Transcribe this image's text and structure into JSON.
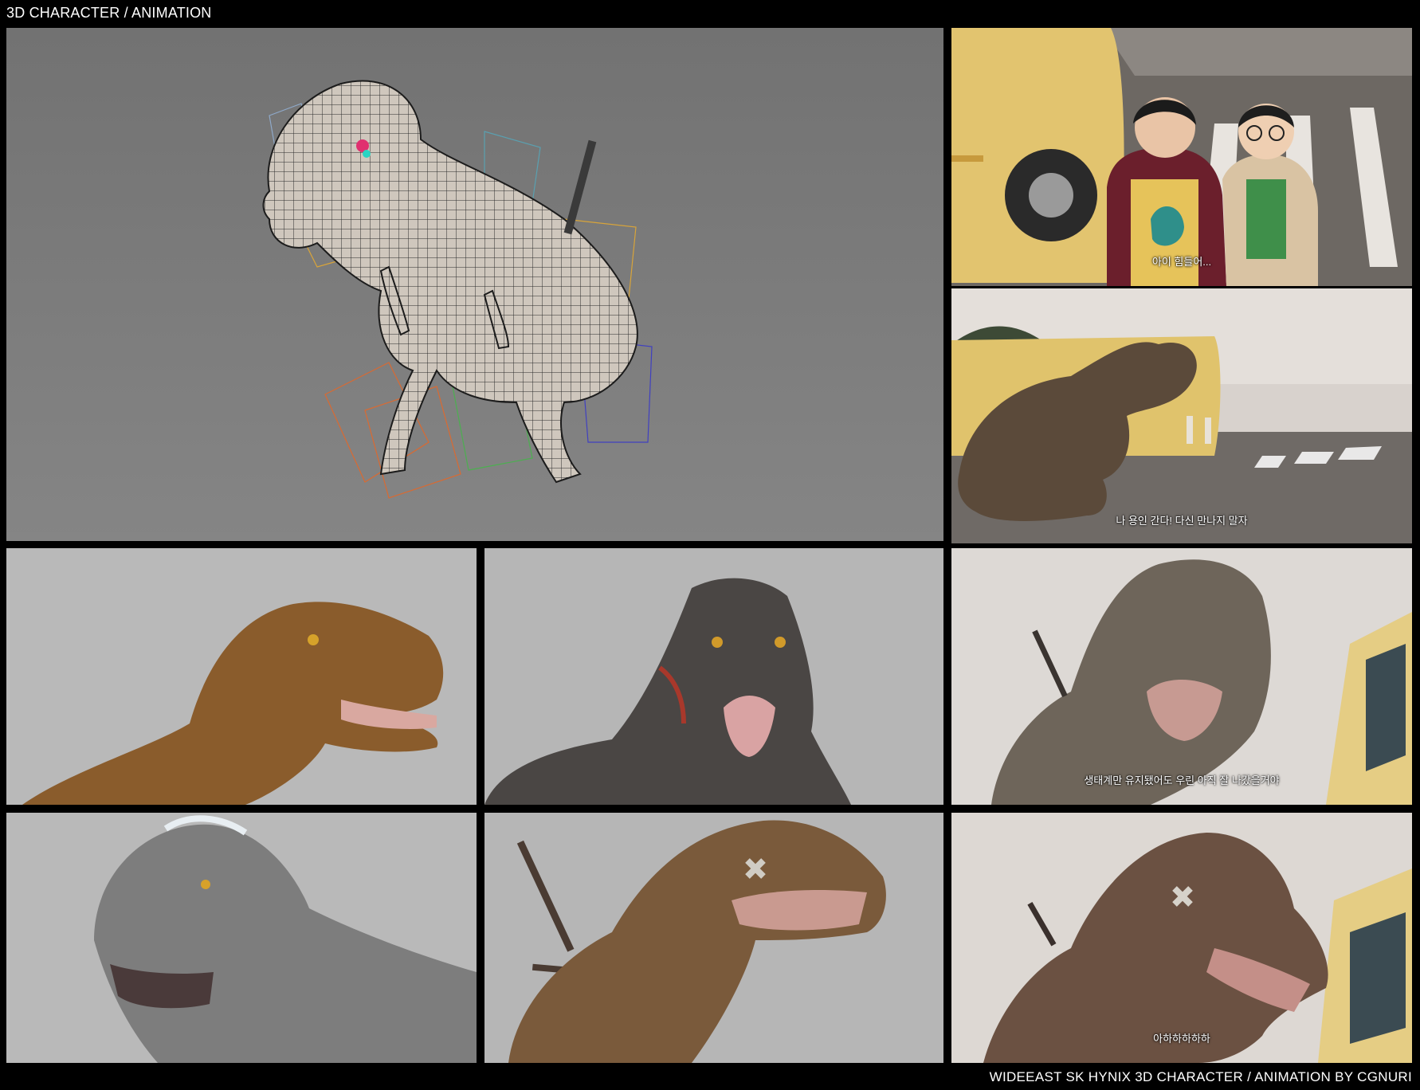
{
  "header": {
    "title": "3D CHARACTER / ANIMATION"
  },
  "footer": {
    "credit": "WIDEEAST SK HYNIX 3D CHARACTER / ANIMATION BY CGNURI"
  },
  "panels": {
    "wireframe": {
      "subject": "t-rex-wireframe-rig"
    },
    "bus_kids": {
      "subtitle": "아이 힘들어..."
    },
    "dino_bus": {
      "subtitle": "나 용인 간다! 다신 만나지 말자"
    },
    "dino_closeup_sky": {
      "subtitle": "생태계만 유지됐어도 우린 아직 잘 나갔을거야"
    },
    "dino_laugh": {
      "subtitle": "아하하하하하"
    }
  },
  "colors": {
    "background": "#000000",
    "studio_grey": "#b9b9b9",
    "wire_grey": "#7a7a7a",
    "bus_yellow": "#e2c46f"
  }
}
